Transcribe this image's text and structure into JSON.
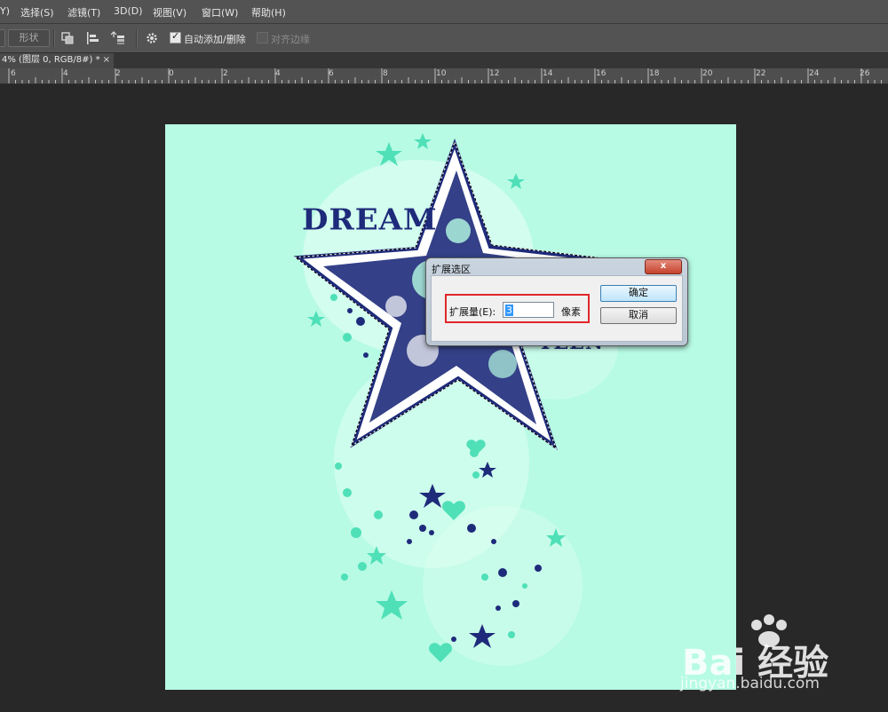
{
  "menu": {
    "items": [
      "Y)",
      "选择(S)",
      "滤镜(T)",
      "3D(D)",
      "视图(V)",
      "窗口(W)",
      "帮助(H)"
    ]
  },
  "options": {
    "shape_label": "形状",
    "auto_add_delete": {
      "label": "自动添加/删除",
      "checked": true
    },
    "align_edges": {
      "label": "对齐边缘",
      "checked": false
    }
  },
  "tab": {
    "title": "4% (图层 0, RGB/8#) *",
    "close_glyph": "×"
  },
  "ruler": {
    "labels": [
      "6",
      "4",
      "2",
      "0",
      "2",
      "4",
      "6",
      "8",
      "10",
      "12",
      "14",
      "16",
      "18",
      "20",
      "22",
      "24",
      "26"
    ]
  },
  "artwork": {
    "word_top": "DREAM",
    "word_bottom": "TEEN",
    "background": "#b7fbe4",
    "accent_navy": "#1e2b7a",
    "accent_teal": "#4fe0b8"
  },
  "dialog": {
    "title": "扩展选区",
    "close_glyph": "x",
    "field_label": "扩展量(E):",
    "field_value": "3",
    "unit": "像素",
    "ok_label": "确定",
    "cancel_label": "取消",
    "highlight_color": "#e0262a"
  },
  "watermark": {
    "brand": "Bai 经验",
    "url": "jingyan.baidu.com"
  }
}
